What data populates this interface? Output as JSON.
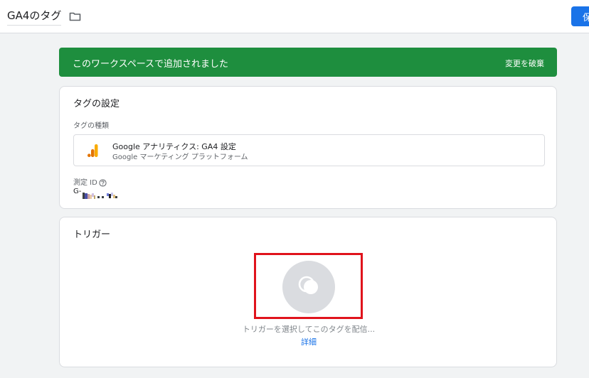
{
  "header": {
    "tag_name": "GA4のタグ",
    "save_label": "保存",
    "icons": {
      "folder": "folder-icon"
    }
  },
  "banner": {
    "message": "このワークスペースで追加されました",
    "discard_label": "変更を破棄",
    "color": "#1e8e3e"
  },
  "tag_config": {
    "title": "タグの設定",
    "tag_type_label": "タグの種類",
    "tag_type": {
      "name": "Google アナリティクス: GA4 設定",
      "platform": "Google マーケティング プラットフォーム",
      "icon": "google-analytics-icon"
    },
    "measurement_id_label": "測定 ID",
    "measurement_id_prefix": "G-"
  },
  "trigger": {
    "title": "トリガー",
    "hint": "トリガーを選択してこのタグを配信...",
    "details_label": "詳細",
    "icon": "trigger-icon"
  },
  "colors": {
    "accent": "#1a73e8",
    "highlight": "#e0131c",
    "analytics_orange": "#f9ab00"
  }
}
